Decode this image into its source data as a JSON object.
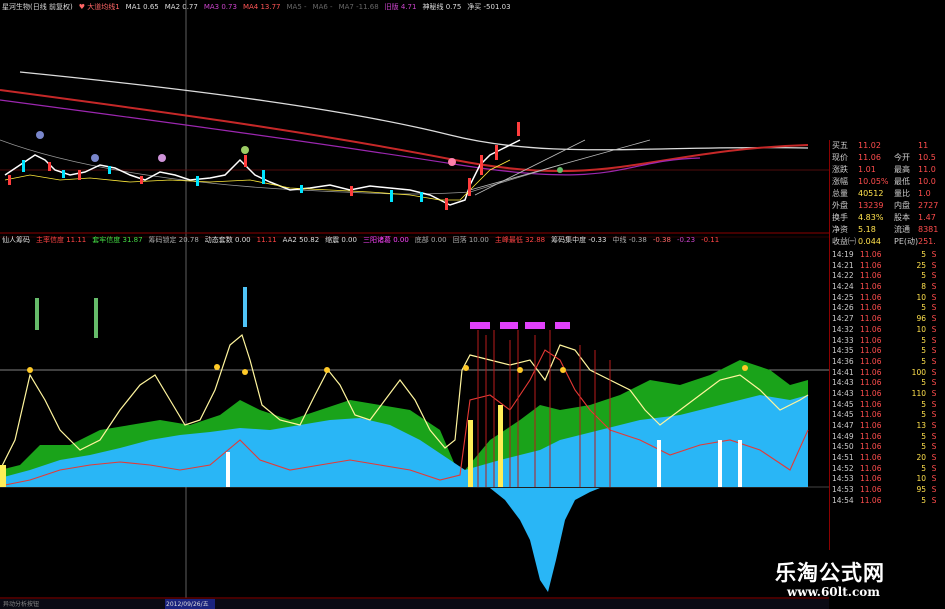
{
  "top_header": {
    "items": [
      {
        "text": "星河生物(日线 前复权)",
        "color": "#dddddd"
      },
      {
        "text": "♥ 大道均线1",
        "color": "#ff6666"
      },
      {
        "text": "MA1 0.65",
        "color": "#dddddd"
      },
      {
        "text": "MA2 0.77",
        "color": "#dddddd"
      },
      {
        "text": "MA3 0.73",
        "color": "#cc44cc"
      },
      {
        "text": "MA4 13.77",
        "color": "#ff5555"
      },
      {
        "text": "MA5 -",
        "color": "#666666"
      },
      {
        "text": "MA6 -",
        "color": "#666666"
      },
      {
        "text": "MA7 -11.68",
        "color": "#666666"
      },
      {
        "text": "旧版 4.71",
        "color": "#cc44cc"
      },
      {
        "text": "神秘线 0.75",
        "color": "#dddddd"
      },
      {
        "text": "净买 -501.03",
        "color": "#dddddd"
      }
    ]
  },
  "mid_header": {
    "items": [
      {
        "text": "仙人筹码",
        "color": "#dddddd"
      },
      {
        "text": "主率信度 11.11",
        "color": "#ff4444"
      },
      {
        "text": "套牢信度 31.87",
        "color": "#44dd44"
      },
      {
        "text": "筹码锁定 20.78",
        "color": "#aaaaaa"
      },
      {
        "text": "动态套数 0.00",
        "color": "#dddddd"
      },
      {
        "text": "11.11",
        "color": "#ff4444"
      },
      {
        "text": "AA2 50.82",
        "color": "#dddddd"
      },
      {
        "text": "缩震 0.00",
        "color": "#dddddd"
      },
      {
        "text": "三阳诸葛 0.00",
        "color": "#ff44ff"
      },
      {
        "text": "底部 0.00",
        "color": "#aaaaaa"
      },
      {
        "text": "回落 10.00",
        "color": "#aaaaaa"
      },
      {
        "text": "主峰最低 32.88",
        "color": "#ff4444"
      },
      {
        "text": "筹码集中度 -0.33",
        "color": "#dddddd"
      },
      {
        "text": "中线 -0.38",
        "color": "#aaaaaa"
      },
      {
        "text": "-0.38",
        "color": "#ff6666"
      },
      {
        "text": "-0.23",
        "color": "#cc44cc"
      },
      {
        "text": "-0.11",
        "color": "#ff4444"
      }
    ]
  },
  "chart_labels": {
    "left_bottom": "异动分析按钮",
    "date_tag": "2012/09/26/五"
  },
  "quote_panel": {
    "rows": [
      {
        "label": "买五",
        "value": "11.02",
        "label2": "",
        "value2": "11",
        "vcolor": "#ff4d4d"
      },
      {
        "label": "现价",
        "value": "11.06",
        "label2": "今开",
        "value2": "10.5",
        "vcolor": "#ff4d4d"
      },
      {
        "label": "涨跌",
        "value": "1.01",
        "label2": "最高",
        "value2": "11.0",
        "vcolor": "#ff4d4d"
      },
      {
        "label": "涨幅",
        "value": "10.05%",
        "label2": "最低",
        "value2": "10.0",
        "vcolor": "#ff4d4d"
      },
      {
        "label": "总量",
        "value": "40512",
        "label2": "量比",
        "value2": "1.0",
        "vcolor": "#ffe14d"
      },
      {
        "label": "外盘",
        "value": "13239",
        "label2": "内盘",
        "value2": "2727",
        "vcolor": "#ff4d4d"
      },
      {
        "label": "换手",
        "value": "4.83%",
        "label2": "股本",
        "value2": "1.47",
        "vcolor": "#ffe14d"
      },
      {
        "label": "净资",
        "value": "5.18",
        "label2": "流通",
        "value2": "8381",
        "vcolor": "#ffe14d"
      },
      {
        "label": "收益㈠",
        "value": "0.044",
        "label2": "PE(动)",
        "value2": "251.",
        "vcolor": "#ffe14d"
      }
    ],
    "ticks": [
      {
        "time": "14:19",
        "price": "11.06",
        "vol": "5",
        "side": "S"
      },
      {
        "time": "14:21",
        "price": "11.06",
        "vol": "25",
        "side": "S"
      },
      {
        "time": "14:22",
        "price": "11.06",
        "vol": "5",
        "side": "S"
      },
      {
        "time": "14:24",
        "price": "11.06",
        "vol": "8",
        "side": "S"
      },
      {
        "time": "14:25",
        "price": "11.06",
        "vol": "10",
        "side": "S"
      },
      {
        "time": "14:26",
        "price": "11.06",
        "vol": "5",
        "side": "S"
      },
      {
        "time": "14:27",
        "price": "11.06",
        "vol": "96",
        "side": "S"
      },
      {
        "time": "14:32",
        "price": "11.06",
        "vol": "10",
        "side": "S"
      },
      {
        "time": "14:33",
        "price": "11.06",
        "vol": "5",
        "side": "S"
      },
      {
        "time": "14:35",
        "price": "11.06",
        "vol": "5",
        "side": "S"
      },
      {
        "time": "14:36",
        "price": "11.06",
        "vol": "5",
        "side": "S"
      },
      {
        "time": "14:41",
        "price": "11.06",
        "vol": "100",
        "side": "S"
      },
      {
        "time": "14:43",
        "price": "11.06",
        "vol": "5",
        "side": "S"
      },
      {
        "time": "14:43",
        "price": "11.06",
        "vol": "110",
        "side": "S"
      },
      {
        "time": "14:45",
        "price": "11.06",
        "vol": "5",
        "side": "S"
      },
      {
        "time": "14:45",
        "price": "11.06",
        "vol": "5",
        "side": "S"
      },
      {
        "time": "14:47",
        "price": "11.06",
        "vol": "13",
        "side": "S"
      },
      {
        "time": "14:49",
        "price": "11.06",
        "vol": "5",
        "side": "S"
      },
      {
        "time": "14:50",
        "price": "11.06",
        "vol": "5",
        "side": "S"
      },
      {
        "time": "14:51",
        "price": "11.06",
        "vol": "20",
        "side": "S"
      },
      {
        "time": "14:52",
        "price": "11.06",
        "vol": "5",
        "side": "S"
      },
      {
        "time": "14:53",
        "price": "11.06",
        "vol": "10",
        "side": "S"
      },
      {
        "time": "14:53",
        "price": "11.06",
        "vol": "95",
        "side": "S"
      },
      {
        "time": "14:54",
        "price": "11.06",
        "vol": "5",
        "side": "S"
      }
    ]
  },
  "watermark": {
    "title": "乐淘公式网",
    "url": "www.60lt.com"
  }
}
